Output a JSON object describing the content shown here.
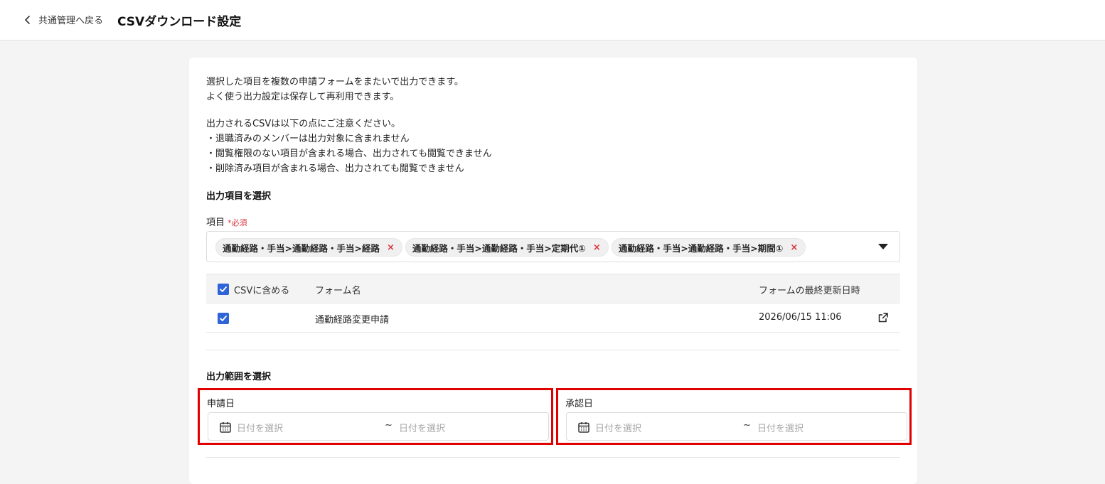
{
  "header": {
    "back_label": "共通管理へ戻る",
    "title": "CSVダウンロード設定"
  },
  "intro": {
    "line1": "選択した項目を複数の申請フォームをまたいで出力できます。",
    "line2": "よく使う出力設定は保存して再利用できます。"
  },
  "notes": {
    "heading": "出力されるCSVは以下の点にご注意ください。",
    "items": [
      "・退職済みのメンバーは出力対象に含まれません",
      "・閲覧権限のない項目が含まれる場合、出力されても閲覧できません",
      "・削除済み項目が含まれる場合、出力されても閲覧できません"
    ]
  },
  "item_section": {
    "title": "出力項目を選択",
    "field_label": "項目",
    "required_text": "*必須",
    "chips": [
      "通勤経路・手当>通勤経路・手当>経路",
      "通勤経路・手当>通勤経路・手当>定期代①",
      "通勤経路・手当>通勤経路・手当>期間①"
    ],
    "chip_remove": "×"
  },
  "table": {
    "headers": {
      "include": "CSVに含める",
      "form_name": "フォーム名",
      "updated": "フォームの最終更新日時"
    },
    "rows": [
      {
        "form_name": "通勤経路変更申請",
        "updated": "2026/06/15 11:06",
        "checked": true
      }
    ]
  },
  "range_section": {
    "title": "出力範囲を選択",
    "apply_date": {
      "label": "申請日",
      "start_placeholder": "日付を選択",
      "separator": "~",
      "end_placeholder": "日付を選択"
    },
    "approve_date": {
      "label": "承認日",
      "start_placeholder": "日付を選択",
      "separator": "~",
      "end_placeholder": "日付を選択"
    }
  },
  "colors": {
    "checkbox": "#2f63d8",
    "required": "#d9363e",
    "highlight": "#e00000"
  }
}
